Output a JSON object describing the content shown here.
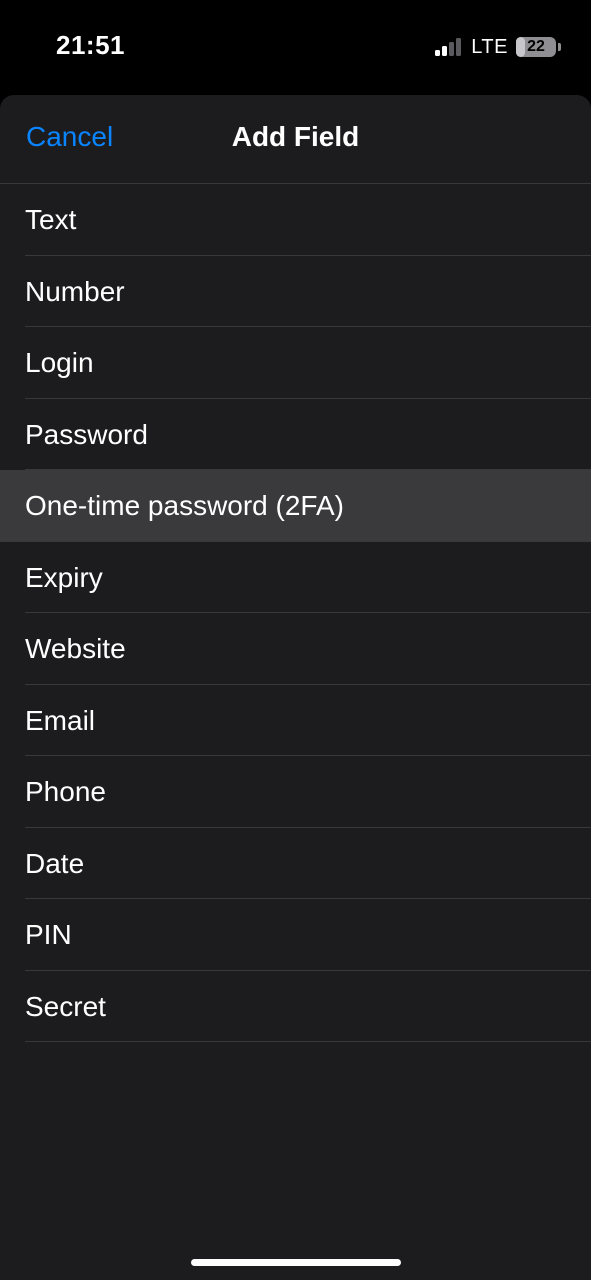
{
  "status_bar": {
    "time": "21:51",
    "network": "LTE",
    "battery_percent": "22",
    "signal_bars_active": 2,
    "signal_bars_total": 4
  },
  "nav": {
    "cancel_label": "Cancel",
    "title": "Add Field"
  },
  "colors": {
    "accent": "#0a84ff",
    "sheet_background": "#1c1c1e",
    "highlight_row": "#3a3a3c"
  },
  "field_types": [
    {
      "label": "Text"
    },
    {
      "label": "Number"
    },
    {
      "label": "Login"
    },
    {
      "label": "Password"
    },
    {
      "label": "One-time password (2FA)",
      "highlighted": true
    },
    {
      "label": "Expiry"
    },
    {
      "label": "Website"
    },
    {
      "label": "Email"
    },
    {
      "label": "Phone"
    },
    {
      "label": "Date"
    },
    {
      "label": "PIN"
    },
    {
      "label": "Secret"
    }
  ]
}
